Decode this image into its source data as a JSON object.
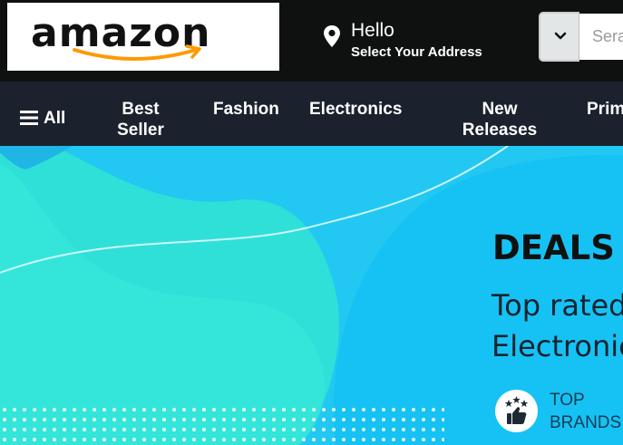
{
  "header": {
    "logo_text": "amazon",
    "greeting": "Hello",
    "address_prompt": "Select Your Address",
    "search": {
      "placeholder": "Serach"
    }
  },
  "nav": {
    "all_label": "All",
    "items": [
      {
        "label": "Best Seller"
      },
      {
        "label": "Fashion"
      },
      {
        "label": "Electronics"
      },
      {
        "label": "New Releases"
      },
      {
        "label": "Prime"
      }
    ]
  },
  "banner": {
    "heading": "DEALS",
    "subtitle_line1": "Top rated",
    "subtitle_line2": "Electronics",
    "badge_line1": "TOP",
    "badge_line2": "BRANDS"
  },
  "colors": {
    "header_bg": "#0f1111",
    "nav_bg": "#1b222d",
    "banner_teal": "#27e3d9",
    "banner_blue": "#1fc6f5",
    "logo_smile": "#ff9900"
  },
  "icons": [
    "location-pin-icon",
    "chevron-down-icon",
    "hamburger-menu-icon",
    "star-badge-icon",
    "thumbs-up-icon"
  ]
}
